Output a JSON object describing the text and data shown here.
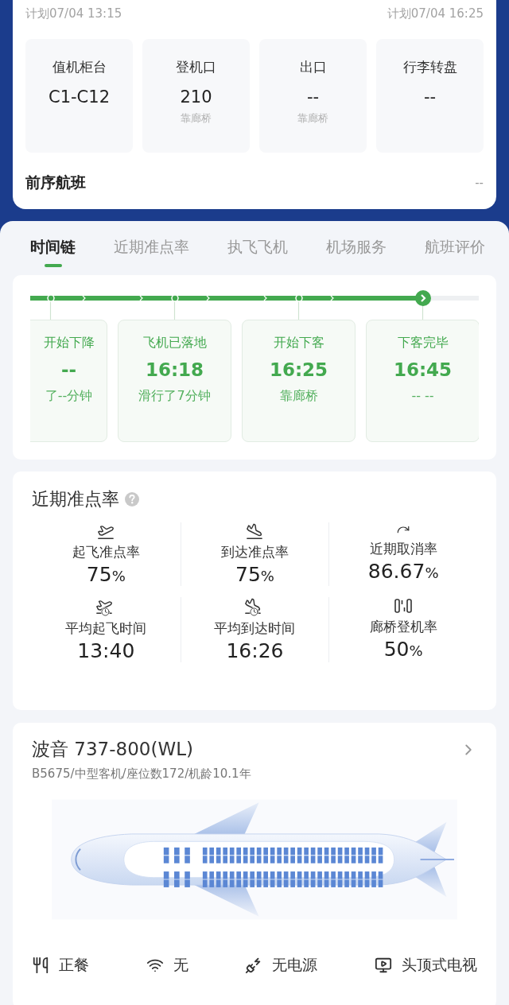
{
  "schedule": {
    "departure_plan": "计划07/04 13:15",
    "arrival_plan": "计划07/04 16:25"
  },
  "info_boxes": [
    {
      "label": "值机柜台",
      "value": "C1-C12"
    },
    {
      "label": "登机口",
      "value": "210",
      "note": "靠廊桥"
    },
    {
      "label": "出口",
      "value": "--",
      "note": "靠廊桥"
    },
    {
      "label": "行李转盘",
      "value": "--"
    }
  ],
  "previous_flight": {
    "label": "前序航班",
    "value": "--"
  },
  "tabs": [
    {
      "label": "时间链",
      "selected": true
    },
    {
      "label": "近期准点率",
      "selected": false
    },
    {
      "label": "执飞飞机",
      "selected": false
    },
    {
      "label": "机场服务",
      "selected": false
    },
    {
      "label": "航班评价",
      "selected": false
    }
  ],
  "timeline": [
    {
      "kind": "partial",
      "title": "开始下降",
      "time": "--",
      "detail": "了--分钟",
      "current": false
    },
    {
      "kind": "full",
      "title": "飞机已落地",
      "time": "16:18",
      "detail": "滑行了7分钟",
      "current": false
    },
    {
      "kind": "full",
      "title": "开始下客",
      "time": "16:25",
      "detail": "靠廊桥",
      "current": false
    },
    {
      "kind": "full",
      "title": "下客完毕",
      "time": "16:45",
      "detail": "-- --",
      "current": true
    }
  ],
  "on_time": {
    "title": "近期准点率",
    "stats": [
      {
        "kind": "takeoff",
        "label": "起飞准点率",
        "value": "75",
        "unit": "%"
      },
      {
        "kind": "landing",
        "label": "到达准点率",
        "value": "75",
        "unit": "%"
      },
      {
        "kind": "cancel",
        "label": "近期取消率",
        "value": "86.67",
        "unit": "%"
      },
      {
        "kind": "takeoff-time",
        "label": "平均起飞时间",
        "value": "13:40"
      },
      {
        "kind": "landing-time",
        "label": "平均到达时间",
        "value": "16:26"
      },
      {
        "kind": "bridge",
        "label": "廊桥登机率",
        "value": "50",
        "unit": "%"
      }
    ]
  },
  "aircraft": {
    "model": "波音 737-800(WL)",
    "details": "B5675/中型客机/座位数172/机龄10.1年",
    "amenities": [
      {
        "kind": "meal",
        "label": "正餐"
      },
      {
        "kind": "wifi",
        "label": "无"
      },
      {
        "kind": "power",
        "label": "无电源"
      },
      {
        "kind": "tv",
        "label": "头顶式电视"
      }
    ]
  }
}
